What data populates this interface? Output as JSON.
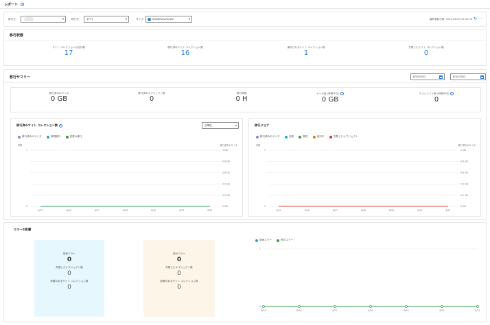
{
  "page": {
    "title": "レポート"
  },
  "filters": {
    "source_label": "移行元:",
    "source_value": "",
    "dest_label": "移行先:",
    "dest_value": "すべて",
    "type_label": "タイプ:",
    "type_value": "SharePoint/OneD",
    "last_updated": "最終更新日時: 2022-08-09 10:35:56"
  },
  "status": {
    "title": "移行状態",
    "stats": [
      {
        "label": "サイト コレクションの合計数",
        "value": "17"
      },
      {
        "label": "移行済みサイト コレクション数",
        "value": "16"
      },
      {
        "label": "保存されるサイト コレクション数",
        "value": "1"
      },
      {
        "label": "失敗したサイト コレクション数",
        "value": "0"
      }
    ]
  },
  "summary": {
    "title": "移行サマリー",
    "date_from": "8/25/2022",
    "date_to": "8/31/2022",
    "stats": [
      {
        "label": "移行済みのサイズ",
        "value": "0 GB",
        "info": false
      },
      {
        "label": "移行済みオブジェクト数",
        "value": "0",
        "info": false
      },
      {
        "label": "移行時間",
        "value": "0 H",
        "info": false
      },
      {
        "label": "データ量 (時間平均)",
        "value": "0 GB",
        "info": true
      },
      {
        "label": "オブジェクト数 (時間平均)",
        "value": "0",
        "info": true
      }
    ]
  },
  "chart_left": {
    "title": "移行済みサイト コレクション数",
    "range_select": "日単位",
    "legend": [
      {
        "name": "移行済みのサイズ",
        "color": "#8b7fd6"
      },
      {
        "name": "新規移行",
        "color": "#2aa7b8"
      },
      {
        "name": "変更の移行",
        "color": "#2e9e44"
      }
    ],
    "y_left_title": "件数",
    "y_right_title": "移行済みのサイズ"
  },
  "chart_right": {
    "title": "移行ジョブ",
    "legend": [
      {
        "name": "移行済みのサイズ",
        "color": "#8b7fd6"
      },
      {
        "name": "完成",
        "color": "#2aa7b8"
      },
      {
        "name": "警告",
        "color": "#2e9e44"
      },
      {
        "name": "進行中",
        "color": "#e07b12"
      },
      {
        "name": "失敗したオブジェクト",
        "color": "#d13438"
      }
    ],
    "y_left_title": "件数",
    "y_right_title": "移行済みのサイズ"
  },
  "errors": {
    "title": "エラーの影響",
    "critical": {
      "title": "致命エラー",
      "value": "0",
      "obj_label": "失敗したオブジェクト数",
      "obj_value": "0",
      "site_label": "影響のあるサイト コレクション数",
      "site_value": "0"
    },
    "other": {
      "title": "他のエラー",
      "value": "0",
      "obj_label": "失敗したオブジェクト数",
      "obj_value": "0",
      "site_label": "影響のあるサイト コレクション数",
      "site_value": "0"
    },
    "legend": [
      {
        "name": "致命エラー",
        "color": "#2aa7b8"
      },
      {
        "name": "他のエラー",
        "color": "#2e9e44"
      }
    ]
  },
  "chart_data": [
    {
      "type": "line",
      "title": "移行済みサイト コレクション数",
      "x": [
        "8/25",
        "8/26",
        "8/27",
        "8/28",
        "8/29",
        "8/30",
        "8/31"
      ],
      "series": [
        {
          "name": "移行済みのサイズ",
          "values": [
            0,
            0,
            0,
            0,
            0,
            0,
            0
          ]
        },
        {
          "name": "新規移行",
          "values": [
            0,
            0,
            0,
            0,
            0,
            0,
            0
          ]
        },
        {
          "name": "変更の移行",
          "values": [
            0,
            0,
            0,
            0,
            0,
            0,
            0
          ]
        }
      ],
      "ylim_left": [
        0,
        1
      ],
      "ylim_right": [
        0,
        1
      ],
      "y_right_ticks": [
        "0 GB",
        "0.2 GB",
        "0.4 GB",
        "0.6 GB",
        "0.8 GB",
        "1 GB"
      ],
      "y_left_ticks": [
        "0",
        "1"
      ]
    },
    {
      "type": "line",
      "title": "移行ジョブ",
      "x": [
        "8/25",
        "8/26",
        "8/27",
        "8/28",
        "8/29",
        "8/30",
        "8/31"
      ],
      "series": [
        {
          "name": "移行済みのサイズ",
          "values": [
            0,
            0,
            0,
            0,
            0,
            0,
            0
          ]
        },
        {
          "name": "完成",
          "values": [
            0,
            0,
            0,
            0,
            0,
            0,
            0
          ]
        },
        {
          "name": "警告",
          "values": [
            0,
            0,
            0,
            0,
            0,
            0,
            0
          ]
        },
        {
          "name": "進行中",
          "values": [
            0,
            0,
            0,
            0,
            0,
            0,
            0
          ]
        },
        {
          "name": "失敗したオブジェクト",
          "values": [
            0,
            0,
            0,
            0,
            0,
            0,
            0
          ]
        }
      ],
      "ylim_left": [
        0,
        1
      ],
      "ylim_right": [
        0,
        1
      ],
      "y_right_ticks": [
        "0 GB",
        "0.2 GB",
        "0.4 GB",
        "0.6 GB",
        "0.8 GB",
        "1 GB"
      ],
      "y_left_ticks": [
        "0",
        "1"
      ]
    },
    {
      "type": "line",
      "title": "エラーの影響",
      "x": [
        "8/25",
        "8/26",
        "8/27",
        "8/28",
        "8/29",
        "8/30",
        "8/31"
      ],
      "series": [
        {
          "name": "致命エラー",
          "values": [
            0,
            0,
            0,
            0,
            0,
            0,
            0
          ]
        },
        {
          "name": "他のエラー",
          "values": [
            0,
            0,
            0,
            0,
            0,
            0,
            0
          ]
        }
      ],
      "ylim": [
        0,
        1
      ],
      "y_ticks": [
        "0",
        "1"
      ]
    }
  ]
}
